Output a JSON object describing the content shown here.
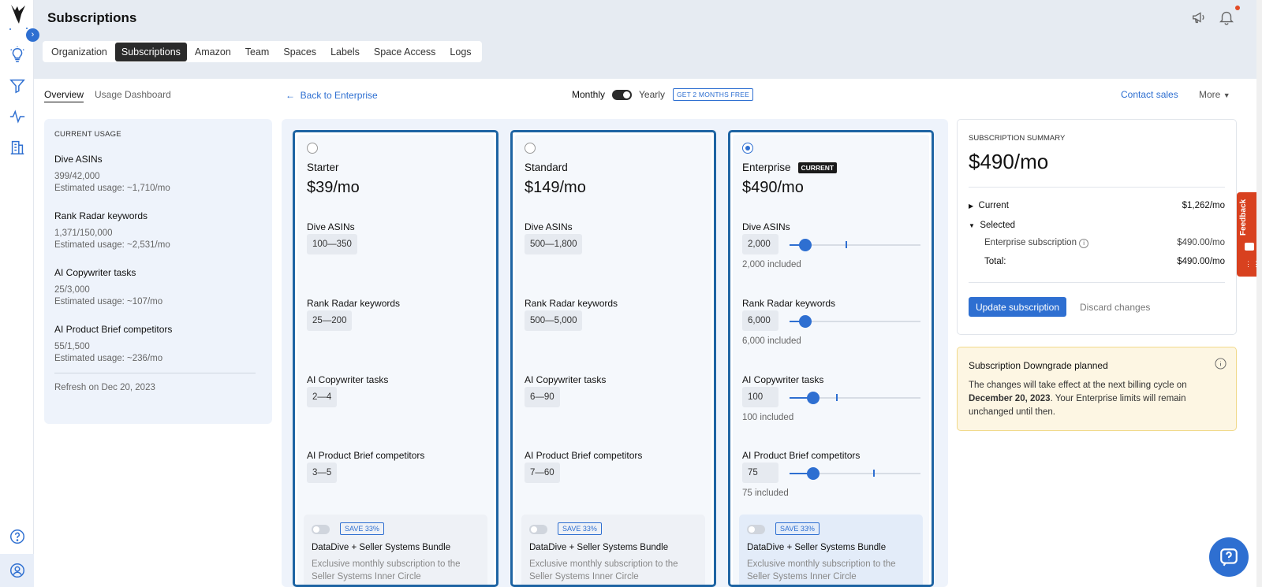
{
  "header": {
    "title": "Subscriptions"
  },
  "tabs": [
    "Organization",
    "Subscriptions",
    "Amazon",
    "Team",
    "Spaces",
    "Labels",
    "Space Access",
    "Logs"
  ],
  "sub_tabs": [
    "Overview",
    "Usage Dashboard"
  ],
  "back_link": "Back to Enterprise",
  "billing": {
    "monthly": "Monthly",
    "yearly": "Yearly",
    "badge": "GET 2 MONTHS FREE"
  },
  "contact_sales": "Contact sales",
  "more": "More",
  "usage": {
    "caption": "CURRENT USAGE",
    "items": [
      {
        "title": "Dive ASINs",
        "value": "399/42,000",
        "estimate": "Estimated usage: ~1,710/mo"
      },
      {
        "title": "Rank Radar keywords",
        "value": "1,371/150,000",
        "estimate": "Estimated usage: ~2,531/mo"
      },
      {
        "title": "AI Copywriter tasks",
        "value": "25/3,000",
        "estimate": "Estimated usage: ~107/mo"
      },
      {
        "title": "AI Product Brief competitors",
        "value": "55/1,500",
        "estimate": "Estimated usage: ~236/mo"
      }
    ],
    "refresh": "Refresh on Dec 20, 2023"
  },
  "feature_labels": [
    "Dive ASINs",
    "Rank Radar keywords",
    "AI Copywriter tasks",
    "AI Product Brief competitors"
  ],
  "plans": [
    {
      "name": "Starter",
      "price": "$39/mo",
      "ranges": [
        "100—350",
        "25—200",
        "2—4",
        "3—5"
      ]
    },
    {
      "name": "Standard",
      "price": "$149/mo",
      "ranges": [
        "500—1,800",
        "500—5,000",
        "6—90",
        "7—60"
      ]
    },
    {
      "name": "Enterprise",
      "price": "$490/mo",
      "badge": "CURRENT",
      "values": [
        "2,000",
        "6,000",
        "100",
        "75"
      ],
      "included": [
        "2,000 included",
        "6,000 included",
        "100 included",
        "75 included"
      ],
      "slider_fill": [
        0.12,
        0.12,
        0.18,
        0.18
      ]
    }
  ],
  "bundle": {
    "save": "SAVE 33%",
    "title": "DataDive + Seller Systems Bundle",
    "desc": "Exclusive monthly subscription to the Seller Systems Inner Circle"
  },
  "summary": {
    "caption": "SUBSCRIPTION SUMMARY",
    "total_big": "$490/mo",
    "current_label": "Current",
    "current_value": "$1,262/mo",
    "selected_label": "Selected",
    "ent_label": "Enterprise subscription",
    "ent_value": "$490.00/mo",
    "total_label": "Total:",
    "total_value": "$490.00/mo",
    "update": "Update subscription",
    "discard": "Discard changes"
  },
  "downgrade": {
    "title": "Subscription Downgrade planned",
    "body_pre": "The changes will take effect at the next billing cycle on ",
    "body_date": "December 20, 2023",
    "body_post": ". Your Enterprise limits will remain unchanged until then."
  },
  "feedback": "Feedback",
  "colors": {
    "accent": "#2e6fd1",
    "plan_border": "#1e64a3",
    "feedback": "#d8411f"
  }
}
